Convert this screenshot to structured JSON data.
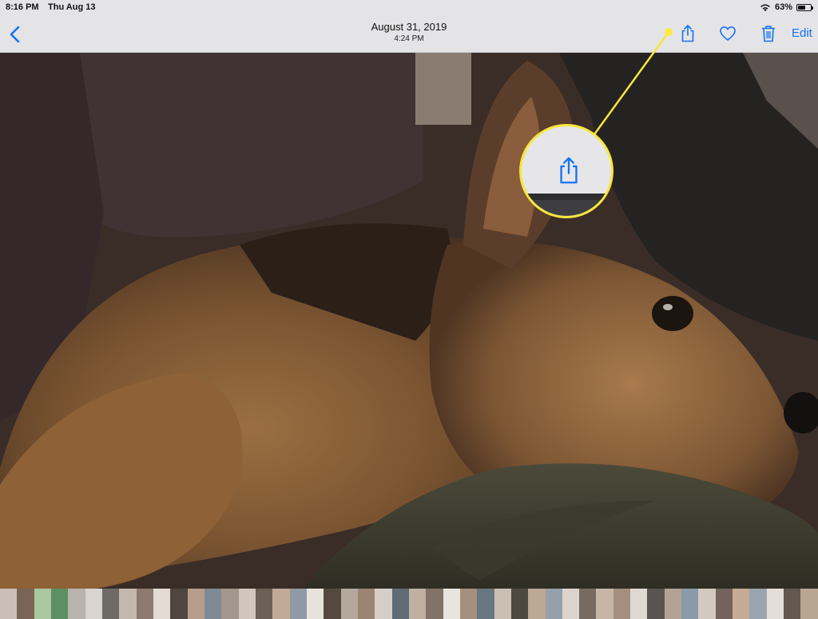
{
  "status_bar": {
    "time": "8:16 PM",
    "date": "Thu Aug 13",
    "battery": "63%",
    "battery_level": 0.63
  },
  "nav_bar": {
    "title_date": "August 31, 2019",
    "title_time": "4:24 PM",
    "edit_label": "Edit"
  },
  "icons": {
    "back": "chevron-left-icon",
    "share": "share-icon",
    "favorite": "heart-icon",
    "delete": "trash-icon",
    "wifi": "wifi-icon",
    "battery": "battery-icon"
  },
  "colors": {
    "accent": "#1273f4",
    "callout": "#f7e63a",
    "bar_background": "#e4e4e6"
  },
  "thumbnail_colors": [
    "#c9bfb8",
    "#7a6458",
    "#a9c7a0",
    "#5c8f63",
    "#b8b3ad",
    "#d9d4cf",
    "#6e6a66",
    "#c4b7ad",
    "#8c7a70",
    "#e3dcd4",
    "#504640",
    "#b79d8c",
    "#7f8a94",
    "#a3968c",
    "#d0c6bd",
    "#6c5f56",
    "#c2a995",
    "#8f9aa4",
    "#e8e2dc",
    "#54483f",
    "#b4a89c",
    "#9c8474",
    "#d6cfc8",
    "#5f6c76",
    "#c0b0a2",
    "#837268",
    "#eae4de",
    "#a58f7e",
    "#6a7680",
    "#cbbfb4",
    "#4e4842",
    "#bda896",
    "#96a0aa",
    "#dcd4cc",
    "#786a60",
    "#c7b6a6",
    "#a48e80",
    "#e0d9d2",
    "#5a5450",
    "#b2a294",
    "#8a9aa8",
    "#d3c9c0",
    "#73635a",
    "#c6aa94",
    "#9aa4ae",
    "#e5ded8",
    "#625850",
    "#b9a592"
  ]
}
